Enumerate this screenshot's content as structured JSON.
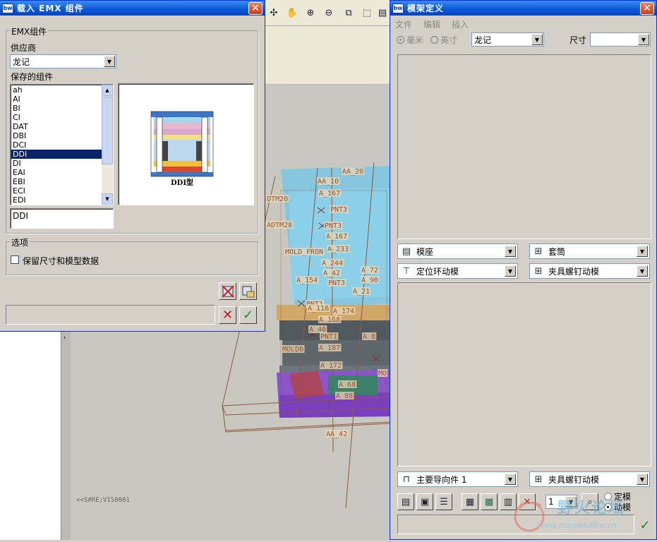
{
  "emx_dialog": {
    "title": "载入 EMX 组件",
    "app_badge": "bw",
    "group_label": "EMX组件",
    "supplier_label": "供应商",
    "supplier_value": "龙记",
    "saved_label": "保存的组件",
    "items": [
      "ah",
      "AI",
      "BI",
      "CI",
      "DAT",
      "DBI",
      "DCI",
      "DDI",
      "DI",
      "EAI",
      "EBI",
      "ECI",
      "EDI"
    ],
    "selected_index": 7,
    "preview_caption": "DDI型",
    "name_value": "DDI",
    "options_label": "选项",
    "keep_checkbox_label": "保留尺寸和模型数据",
    "keep_checked": false,
    "status_value": ""
  },
  "mold_dialog": {
    "title": "模架定义",
    "app_badge": "bw",
    "menu": [
      "文件",
      "编辑",
      "插入"
    ],
    "unit_mm": "毫米",
    "unit_inch": "英寸",
    "supplier_value": "龙记",
    "size_label": "尺寸",
    "size_value": "",
    "combo_row1_left": "模座",
    "combo_row1_right": "套筒",
    "combo_row2_left": "定位环动模",
    "combo_row2_right": "夹具螺钉动模",
    "combo_row3_left": "主要导向件 1",
    "combo_row3_right": "夹具螺钉动模",
    "spin_value": "1",
    "radio_fixed": "定模",
    "radio_moving": "动模",
    "radio_selected": "动模"
  },
  "viewport": {
    "hint_text": "<<S#RE;VIS0001",
    "colors": {
      "cyan": "#6fc6e8",
      "purple": "#8a55c8",
      "dark": "#505a5e",
      "tan": "#d2a868",
      "green": "#2f8a5a",
      "red_label": "#a0522d"
    },
    "labels": [
      "AA_20",
      "AA_10",
      "A_167",
      "DTM20",
      "PNT3",
      "ADTM28",
      "PNT3",
      "A_167",
      "MOLD_FRON",
      "A_233",
      "A_244",
      "A_42",
      "A_72",
      "A_154",
      "PNT3",
      "A_90",
      "A_21",
      "PNT1",
      "A_116",
      "A_174",
      "A_168",
      "A_40",
      "PNT1",
      "A_187",
      "A_8",
      "MOLDB",
      "A_172",
      "MO",
      "A_68",
      "A_88",
      "AA_42"
    ]
  },
  "watermark": {
    "text": "野火论坛",
    "url": "www.proewildfire.cn"
  }
}
